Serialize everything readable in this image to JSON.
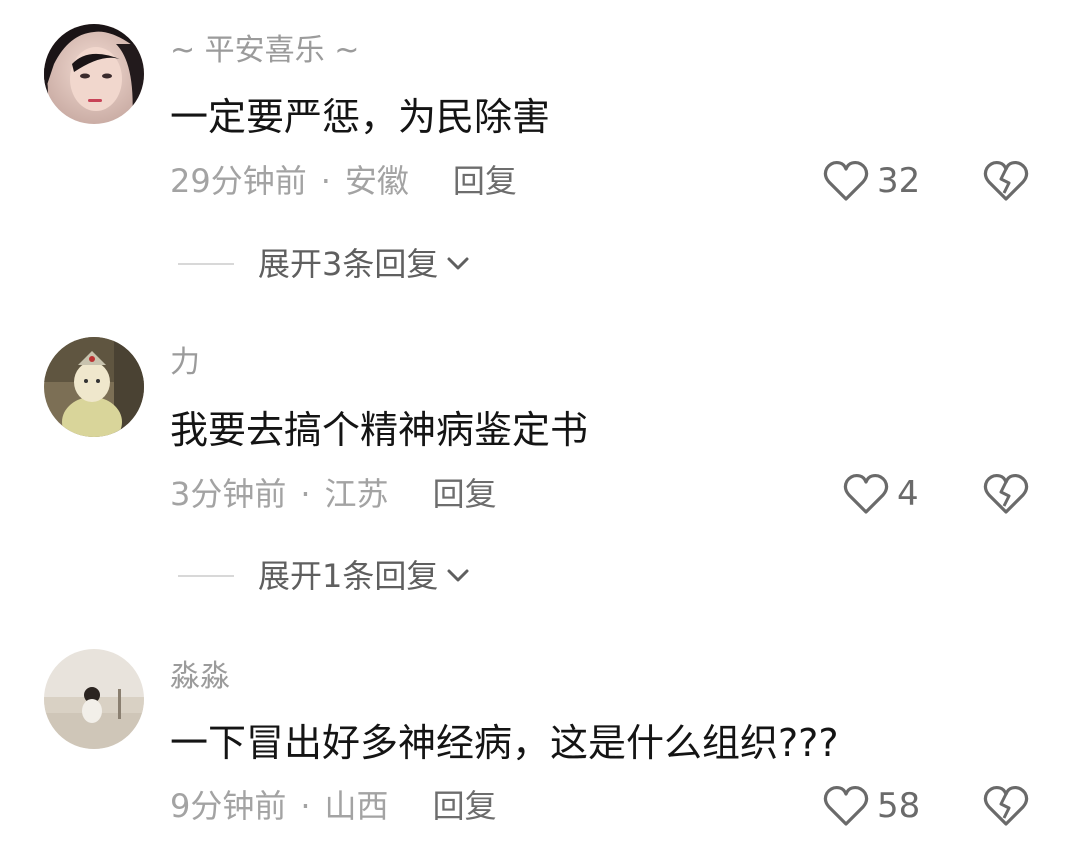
{
  "comments": [
    {
      "username": "~ 平安喜乐 ~",
      "content": "一定要严惩，为民除害",
      "time": "29分钟前",
      "separator": "·",
      "location": "安徽",
      "reply_label": "回复",
      "likes": "32",
      "expand_label": "展开3条回复",
      "avatar_icon": "avatar-woman-portrait"
    },
    {
      "username": "力",
      "content": "我要去搞个精神病鉴定书",
      "time": "3分钟前",
      "separator": "·",
      "location": "江苏",
      "reply_label": "回复",
      "likes": "4",
      "expand_label": "展开1条回复",
      "avatar_icon": "avatar-cartoon-figure"
    },
    {
      "username": "淼淼",
      "content": "一下冒出好多神经病，这是什么组织???",
      "time": "9分钟前",
      "separator": "·",
      "location": "山西",
      "reply_label": "回复",
      "likes": "58",
      "avatar_icon": "avatar-child-on-couch"
    }
  ],
  "icons": {
    "like": "heart-outline-icon",
    "dislike": "broken-heart-icon",
    "expand": "chevron-down-icon"
  },
  "colors": {
    "username": "#9b9b9b",
    "content": "#141414",
    "meta": "#a3a3a3",
    "reply": "#6d6d6d",
    "icon": "#6a6a6a"
  }
}
